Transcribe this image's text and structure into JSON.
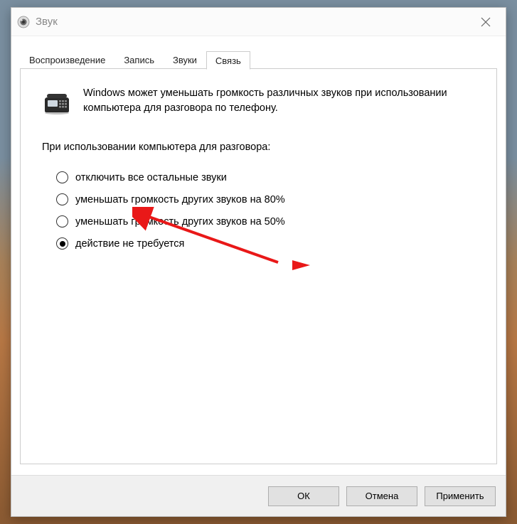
{
  "window": {
    "title": "Звук"
  },
  "tabs": [
    {
      "label": "Воспроизведение",
      "active": false
    },
    {
      "label": "Запись",
      "active": false
    },
    {
      "label": "Звуки",
      "active": false
    },
    {
      "label": "Связь",
      "active": true
    }
  ],
  "description": "Windows может уменьшать громкость различных звуков при использовании компьютера для разговора по телефону.",
  "question": "При использовании компьютера для разговора:",
  "options": [
    {
      "label": "отключить все остальные звуки",
      "selected": false
    },
    {
      "label": "уменьшать громкость других звуков на 80%",
      "selected": false
    },
    {
      "label": "уменьшать громкость других звуков на 50%",
      "selected": false
    },
    {
      "label": "действие не требуется",
      "selected": true
    }
  ],
  "buttons": {
    "ok": "ОК",
    "cancel": "Отмена",
    "apply": "Применить"
  }
}
